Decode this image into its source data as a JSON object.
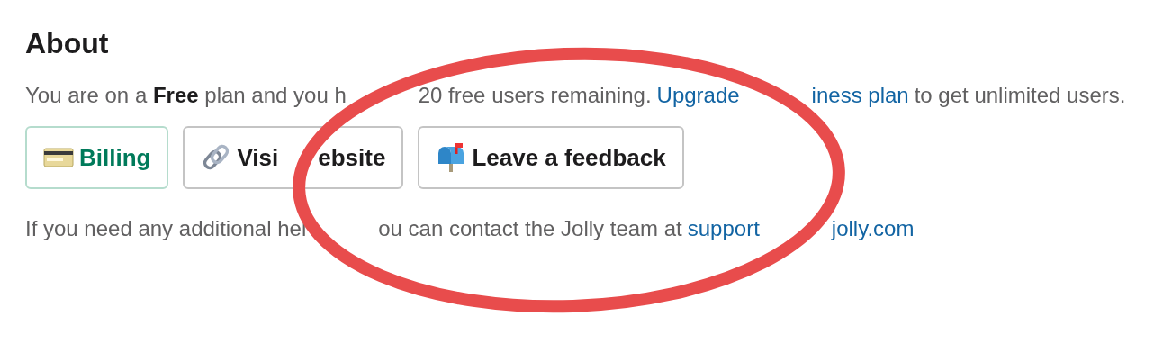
{
  "heading": "About",
  "plan_line": [
    [
      {
        "kind": "text",
        "text": "You are on a **Free** plan and you h"
      }
    ],
    [
      {
        "kind": "text",
        "text": "20 free users remaining."
      },
      {
        "kind": "link",
        "text": "Upgrade"
      }
    ],
    [
      {
        "kind": "link",
        "text": "iness plan"
      },
      {
        "kind": "text",
        "text": "to get unlimited users."
      }
    ]
  ],
  "buttons": [
    {
      "kind": "billing",
      "segments": [
        "Billing"
      ]
    },
    {
      "kind": "website",
      "segments": [
        "Visi",
        "ebsite"
      ]
    },
    {
      "kind": "feedback",
      "segments": [
        "Leave a feedback"
      ]
    }
  ],
  "help_line": [
    [
      {
        "kind": "text",
        "text": "If you need any additional hel"
      }
    ],
    [
      {
        "kind": "text",
        "text": "ou can contact the Jolly team at"
      },
      {
        "kind": "link",
        "text": "support"
      }
    ],
    [
      {
        "kind": "link",
        "text": "jolly.com"
      }
    ]
  ],
  "annotation": {
    "kind": "ellipse",
    "color": "#e84c4c"
  }
}
